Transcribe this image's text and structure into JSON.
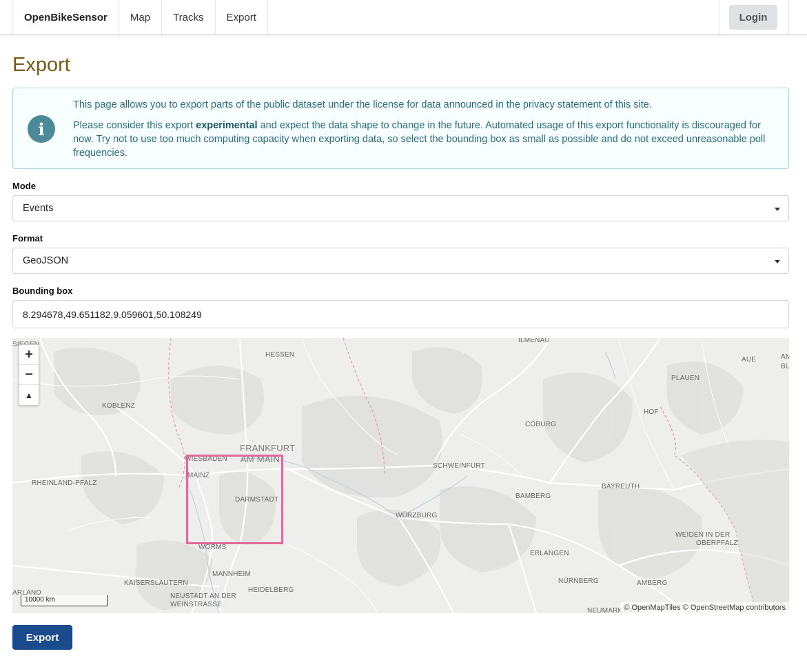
{
  "nav": {
    "brand": "OpenBikeSensor",
    "items": [
      {
        "label": "Map"
      },
      {
        "label": "Tracks"
      },
      {
        "label": "Export"
      }
    ],
    "login_label": "Login"
  },
  "page": {
    "title": "Export"
  },
  "info": {
    "icon": "info-circle-icon",
    "paragraph1": "This page allows you to export parts of the public dataset under the license for data announced in the privacy statement of this site.",
    "paragraph2_prefix": "Please consider this export ",
    "paragraph2_bold": "experimental",
    "paragraph2_suffix": " and expect the data shape to change in the future. Automated usage of this export functionality is discouraged for now. Try not to use too much computing capacity when exporting data, so select the bounding box as small as possible and do not exceed unreasonable poll frequencies."
  },
  "form": {
    "mode_label": "Mode",
    "mode_value": "Events",
    "format_label": "Format",
    "format_value": "GeoJSON",
    "bbox_label": "Bounding box",
    "bbox_value": "8.294678,49.651182,9.059601,50.108249"
  },
  "map": {
    "zoom_in": "+",
    "zoom_out": "−",
    "reset_north": "▲",
    "scale_label": "10000 km",
    "attribution": "© OpenMapTiles © OpenStreetMap contributors",
    "labels": {
      "ilmenau": "ILMENAU",
      "hessen": "HESSEN",
      "aue": "AUE",
      "plauen": "PLAUEN",
      "koblenz": "KOBLENZ",
      "hof": "HOF",
      "coburg": "COBURG",
      "frankfurt1": "FRANKFURT",
      "frankfurt2": "AM MAIN",
      "wiesbaden": "WIESBADEN",
      "mainz": "MAINZ",
      "schweinfurt": "SCHWEINFURT",
      "rheinland": "RHEINLAND-PFALZ",
      "darmstadt": "DARMSTADT",
      "bamberg": "BAMBERG",
      "bayreuth": "BAYREUTH",
      "wuerzburg": "WÜRZBURG",
      "weiden1": "WEIDEN IN DER",
      "weiden2": "OBERPFALZ",
      "worms": "WORMS",
      "erlangen": "ERLANGEN",
      "mannheim": "MANNHEIM",
      "kaiserslautern": "KAISERSLAUTERN",
      "nuernberg": "NÜRNBERG",
      "amberg": "AMBERG",
      "neustadt1": "NEUSTADT AN DER",
      "neustadt2": "WEINSTRASSE",
      "heidelberg": "HEIDELBERG",
      "saarland": "ARLAND",
      "siegen": "SIEGEN",
      "neumarkt": "NEUMARKT IN",
      "am": "AM",
      "bu": "BU"
    }
  },
  "actions": {
    "export_label": "Export"
  },
  "colors": {
    "primary": "#1a4b8c",
    "bbox": "#e06a95",
    "info_bg": "#f8ffff",
    "info_text": "#276f86"
  }
}
